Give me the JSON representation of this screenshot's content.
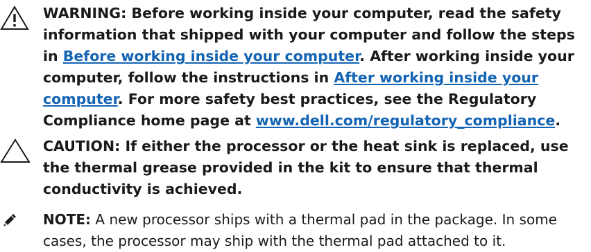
{
  "warning": {
    "icon": "warning-triangle-icon",
    "part1": "WARNING: Before working inside your computer, read the safety information that shipped with your computer and follow the steps in ",
    "link1": "Before working inside your computer",
    "part2": ". After working inside your computer, follow the instructions in ",
    "link2": "After working inside your computer",
    "part3": ". For more safety best practices, see the Regulatory Compliance home page at ",
    "link3": "www.dell.com/regulatory_compliance",
    "part4": "."
  },
  "caution": {
    "icon": "caution-triangle-icon",
    "text": "CAUTION: If either the processor or the heat sink is replaced, use the thermal grease provided in the kit to ensure that thermal conductivity is achieved."
  },
  "note": {
    "icon": "note-pencil-icon",
    "label": "NOTE:",
    "text": " A new processor ships with a thermal pad in the package. In some cases, the processor may ship with the thermal pad attached to it."
  },
  "colors": {
    "link": "#1464b4",
    "text": "#1a1a1a"
  }
}
